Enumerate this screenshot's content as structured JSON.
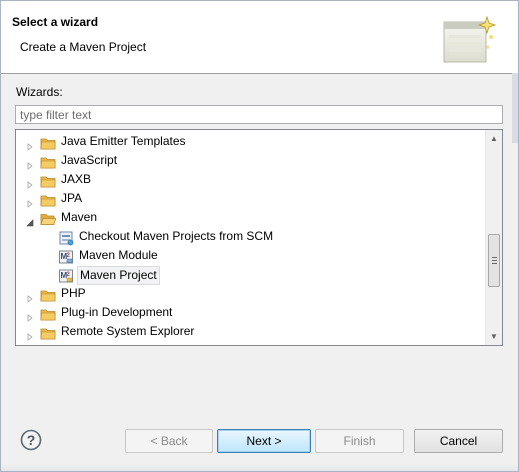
{
  "header": {
    "title": "Select a wizard",
    "description": "Create a Maven Project"
  },
  "wizards_label": "Wizards:",
  "filter": {
    "value": "",
    "placeholder": "type filter text"
  },
  "tree": {
    "items": [
      {
        "label": "Java Emitter Templates",
        "icon": "folder-icon",
        "level": 0,
        "expander": "collapsed"
      },
      {
        "label": "JavaScript",
        "icon": "folder-icon",
        "level": 0,
        "expander": "collapsed"
      },
      {
        "label": "JAXB",
        "icon": "folder-icon",
        "level": 0,
        "expander": "collapsed"
      },
      {
        "label": "JPA",
        "icon": "folder-icon",
        "level": 0,
        "expander": "collapsed"
      },
      {
        "label": "Maven",
        "icon": "open-folder-icon",
        "level": 0,
        "expander": "expanded"
      },
      {
        "label": "Checkout Maven Projects from SCM",
        "icon": "maven-scm-icon",
        "level": 1,
        "expander": "none"
      },
      {
        "label": "Maven Module",
        "icon": "maven-module-icon",
        "level": 1,
        "expander": "none"
      },
      {
        "label": "Maven Project",
        "icon": "maven-project-icon",
        "level": 1,
        "expander": "none",
        "selected": true
      },
      {
        "label": "PHP",
        "icon": "folder-icon",
        "level": 0,
        "expander": "collapsed"
      },
      {
        "label": "Plug-in Development",
        "icon": "folder-icon",
        "level": 0,
        "expander": "collapsed"
      },
      {
        "label": "Remote System Explorer",
        "icon": "folder-icon",
        "level": 0,
        "expander": "collapsed"
      }
    ]
  },
  "buttons": {
    "back": "< Back",
    "next": "Next >",
    "finish": "Finish",
    "cancel": "Cancel"
  },
  "colors": {
    "folder": "#e8b84a",
    "folder_dark": "#c08a1e",
    "selection_bg": "#f2f3f4",
    "default_button_border": "#3c7fb1"
  }
}
